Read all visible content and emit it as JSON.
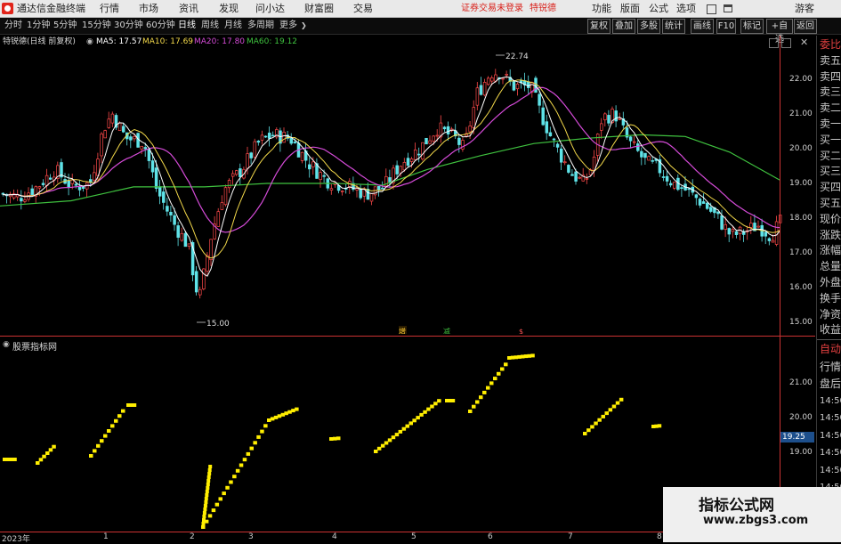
{
  "menubar": {
    "app_title": "通达信金融终端",
    "menus": [
      "行情",
      "市场",
      "资讯",
      "发现",
      "问小达",
      "财富圈",
      "交易"
    ],
    "notice": "证券交易未登录",
    "brand": "特锐德",
    "right_menus": [
      "功能",
      "版面",
      "公式",
      "选项"
    ],
    "guest": "游客"
  },
  "toolbar": {
    "periods": [
      "分时",
      "1分钟",
      "5分钟",
      "15分钟",
      "30分钟",
      "60分钟",
      "日线",
      "周线",
      "月线",
      "多周期",
      "更多"
    ],
    "active_period": "日线",
    "right_buttons": [
      "复权",
      "叠加",
      "多股",
      "统计",
      "画线",
      "F10",
      "标记",
      "+自选",
      "返回"
    ]
  },
  "infobar": {
    "stock": "特锐德(日线 前复权)",
    "ma5": "MA5: 17.57",
    "ma10": "MA10: 17.69",
    "ma20": "MA20: 17.80",
    "ma60": "MA60: 19.12"
  },
  "price_axis": [
    "22.00",
    "21.00",
    "20.00",
    "19.00",
    "18.00",
    "17.00",
    "16.00",
    "15.00"
  ],
  "annotations": {
    "high": "22.74",
    "low": "15.00",
    "markers": [
      "增",
      "减",
      "$"
    ]
  },
  "indicator": {
    "title": "股票指标网",
    "axis": [
      "21.00",
      "20.00",
      "19.00"
    ],
    "current_value": "19.25"
  },
  "time_axis": [
    "2023年",
    "1",
    "2",
    "3",
    "4",
    "5",
    "6",
    "7",
    "8"
  ],
  "right_panel": {
    "top_items": [
      "委比",
      "卖五",
      "卖四",
      "卖三",
      "卖二",
      "卖一",
      "买一",
      "买二",
      "买三",
      "买四",
      "买五",
      "现价",
      "涨跌",
      "涨幅",
      "总量",
      "外盘",
      "换手",
      "净资",
      "收益"
    ],
    "bottom_items": [
      "自动",
      "行情",
      "盘后",
      "14:50",
      "14:50",
      "14:50",
      "14:50",
      "14:50",
      "14:50"
    ]
  },
  "watermark": {
    "line1": "指标公式网",
    "line2": "www.zbgs3.com"
  },
  "colors": {
    "up": "#ff4a4a",
    "down": "#5fe3e8",
    "ma5": "#ffffff",
    "ma10": "#f2d84a",
    "ma20": "#d54bd8",
    "ma60": "#3fc23f",
    "indicator": "#ffee00",
    "menu_red": "#d9221c"
  }
}
